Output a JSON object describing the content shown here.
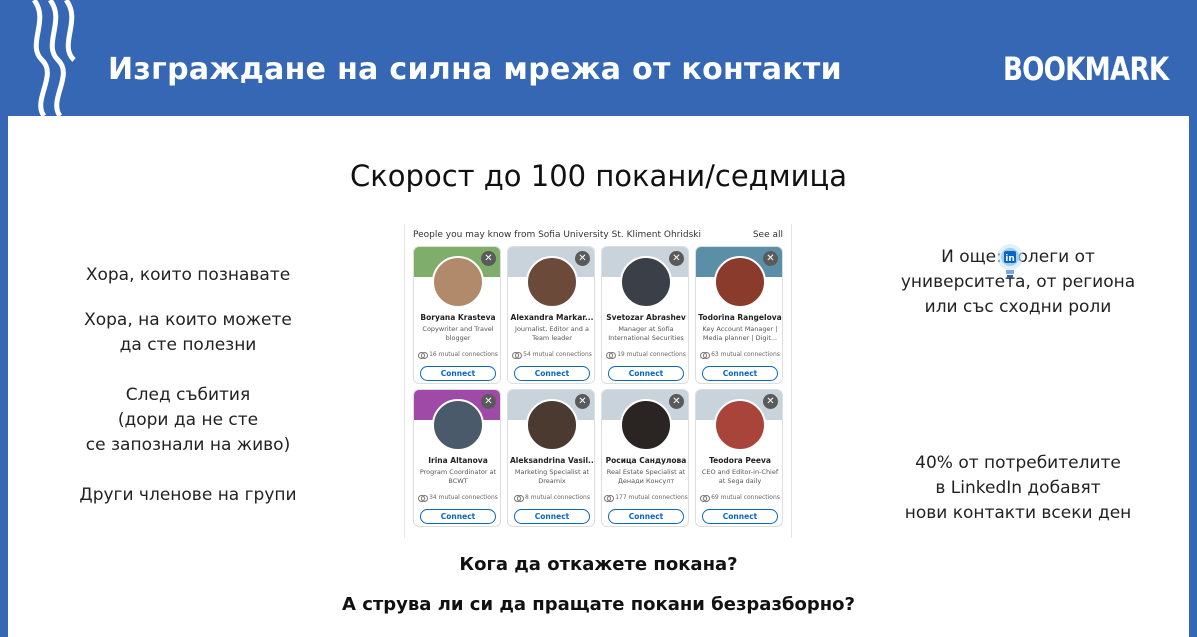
{
  "header": {
    "title": "Изграждане на силна мрежа от контакти",
    "logo": "BOOKMARK"
  },
  "subtitle": "Скорост до 100 покани/седмица",
  "left_items": [
    "Хора, които познавате",
    "Хора, на които можете да сте полезни",
    "След събития (дори да не сте се запознали на живо)",
    "Други членове на групи"
  ],
  "left_lines": [
    [
      "Хора, които познавате"
    ],
    [
      "Хора, на които можете",
      "да сте полезни"
    ],
    [
      "След събития",
      "(дори да не сте",
      "се запознали на живо)"
    ],
    [
      "Други членове на групи"
    ]
  ],
  "right_top": [
    "И още: колеги от",
    "университета, от региона",
    "или със сходни роли"
  ],
  "right_bottom": [
    "40% от потребителите",
    "в LinkedIn добавят",
    "нови контакти всеки ден"
  ],
  "questions": {
    "q1": "Кога да откажете покана?",
    "q2": "А струва ли си да пращате покани безразборно?"
  },
  "widget": {
    "heading": "People you may know from Sofia University St. Kliment Ohridski",
    "see_all": "See all",
    "connect_label": "Connect",
    "close_glyph": "✕",
    "cards": [
      {
        "name": "Boryana Krasteva",
        "role": "Copywriter and Travel blogger",
        "mutual": "16 mutual connections",
        "cover": "#7fae6a",
        "avatar": "#b08a6a"
      },
      {
        "name": "Alexandra Markar...",
        "role": "Journalist, Editor and a Team leader",
        "mutual": "54 mutual connections",
        "cover": "#c9d3dc",
        "avatar": "#6b4a3a"
      },
      {
        "name": "Svetozar Abrashev",
        "role": "Manager at Sofia International Securities",
        "mutual": "19 mutual connections",
        "cover": "#c9d3dc",
        "avatar": "#3b3f48"
      },
      {
        "name": "Todorina Rangelova",
        "role": "Key Account Manager | Media planner | Digit...",
        "mutual": "63 mutual connections",
        "cover": "#5b8fa8",
        "avatar": "#8a3b2b"
      },
      {
        "name": "Irina Altanova",
        "role": "Program Coordinator at BCWT",
        "mutual": "34 mutual connections",
        "cover": "#a04aa8",
        "avatar": "#4a5a6a"
      },
      {
        "name": "Aleksandrina Vasil...",
        "role": "Marketing Specialist at Dreamix",
        "mutual": "8 mutual connections",
        "cover": "#c9d3dc",
        "avatar": "#4a3a30"
      },
      {
        "name": "Росица Сандулова",
        "role": "Real Estate Specialist at Денади Консулт",
        "mutual": "177 mutual connections",
        "cover": "#c9d3dc",
        "avatar": "#2a2422"
      },
      {
        "name": "Teodora Peeva",
        "role": "CEO and Editor-in-Chief at Sega daily",
        "mutual": "69 mutual connections",
        "cover": "#c9d3dc",
        "avatar": "#a8443a"
      }
    ]
  }
}
